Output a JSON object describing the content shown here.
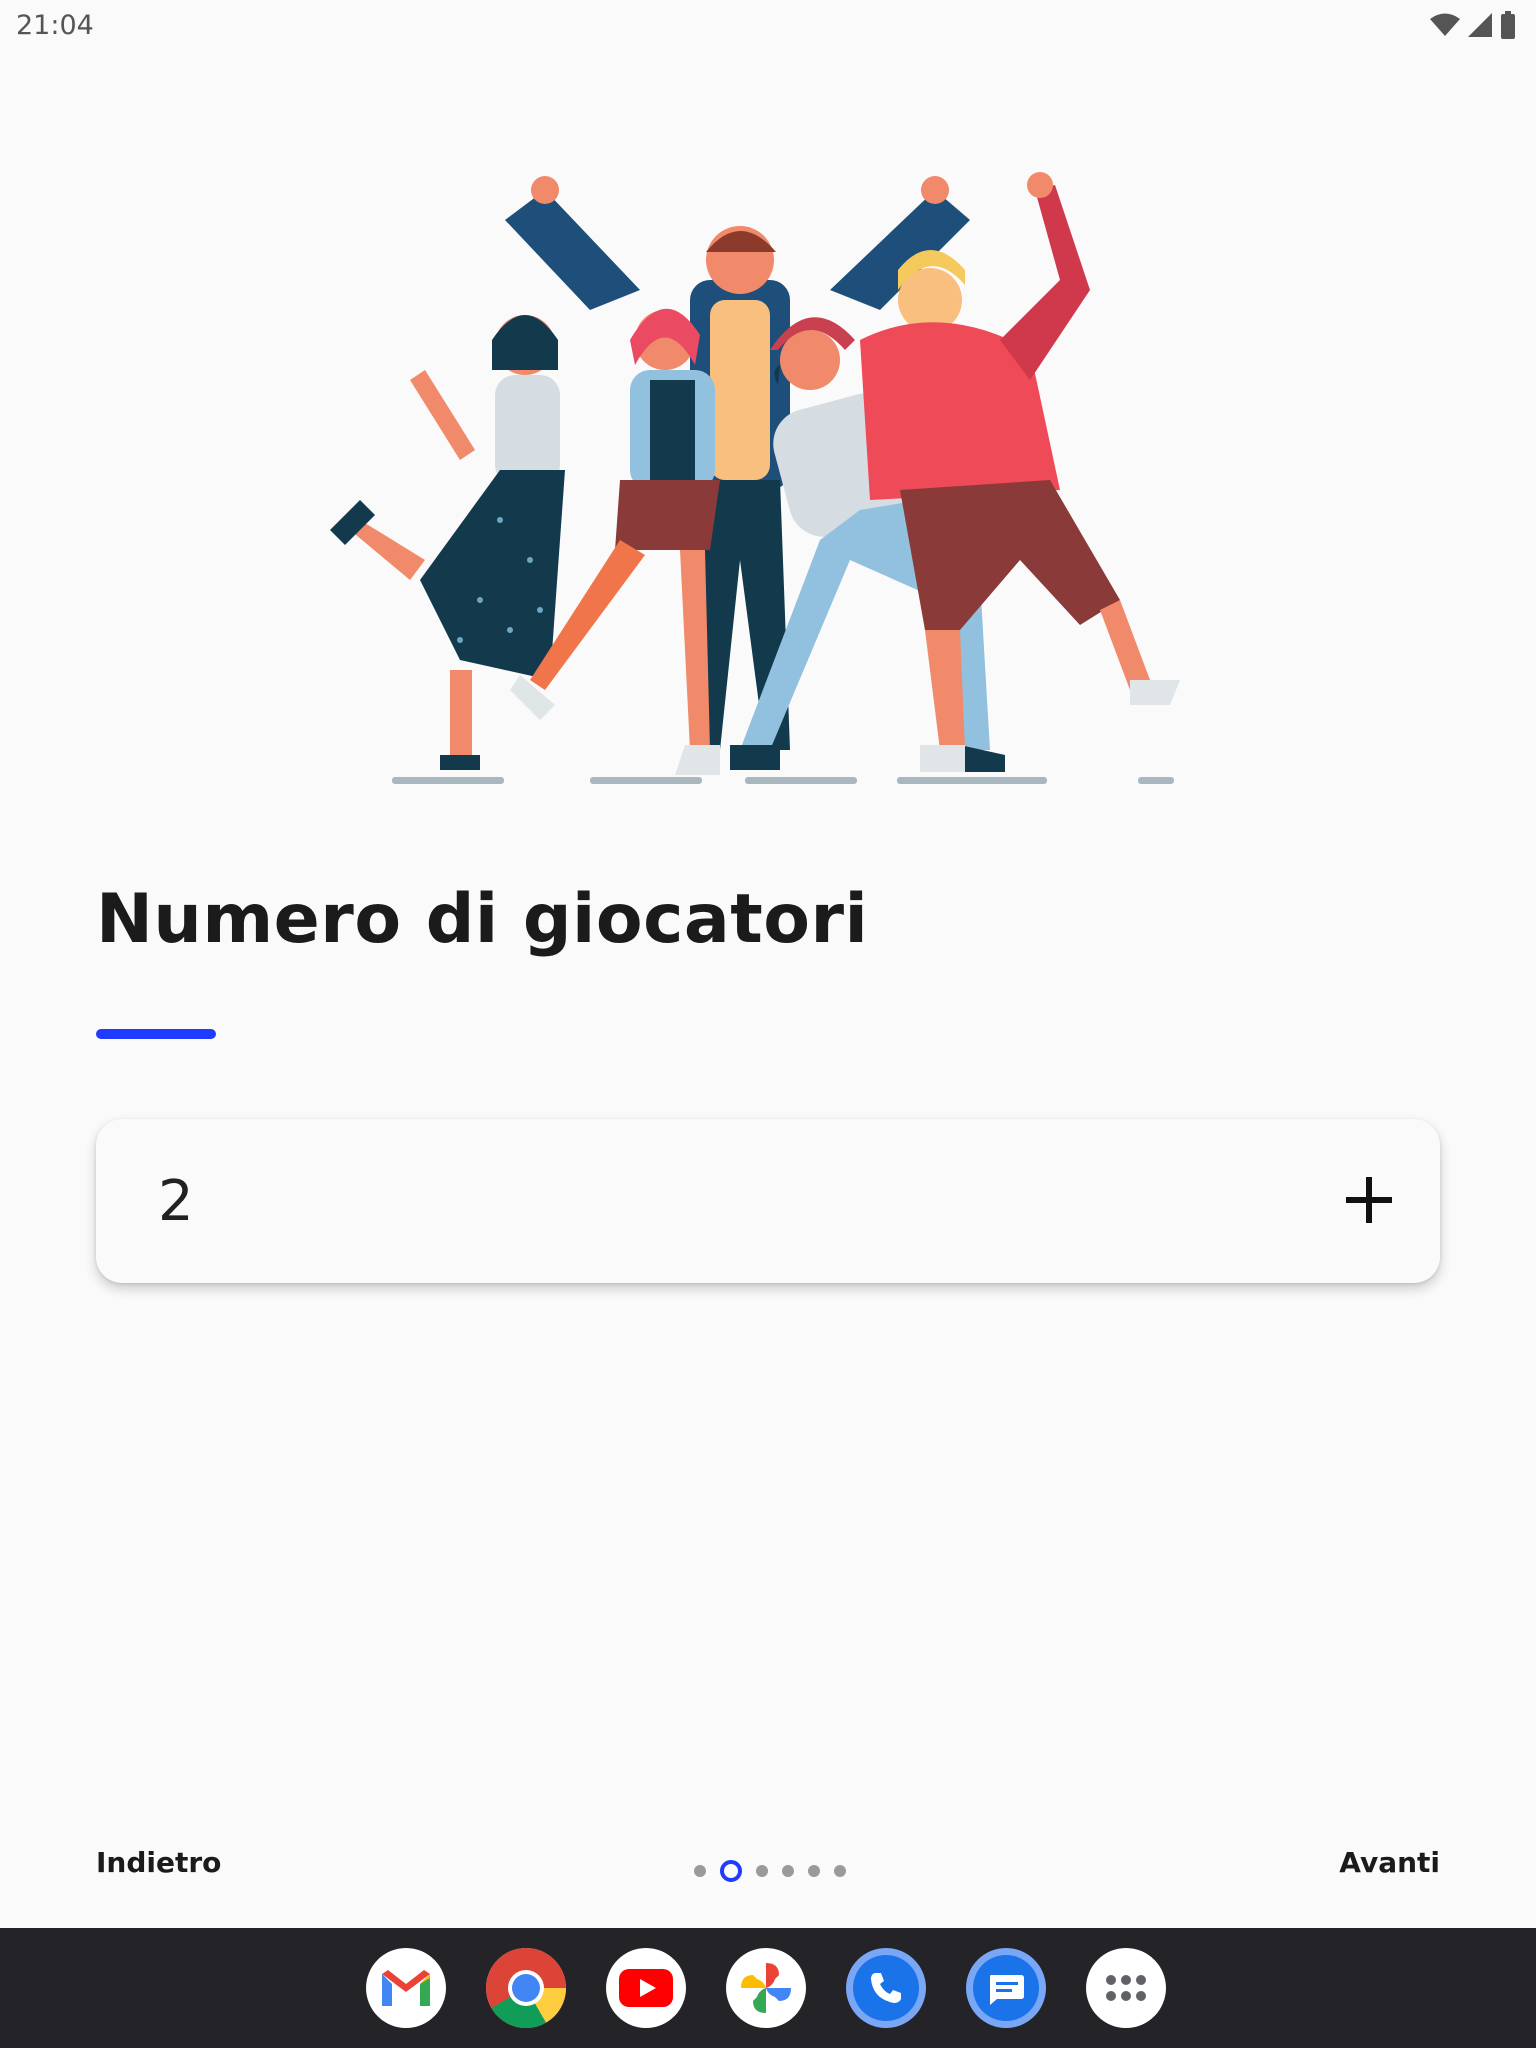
{
  "status_bar": {
    "time": "21:04"
  },
  "page": {
    "title": "Numero di giocatori",
    "player_count": "2"
  },
  "navigation": {
    "back_label": "Indietro",
    "next_label": "Avanti",
    "page_dots": 6,
    "active_page_index": 1
  },
  "dock": {
    "apps": [
      "gmail-icon",
      "chrome-icon",
      "youtube-icon",
      "photos-icon",
      "phone-icon",
      "messages-icon",
      "app-drawer-icon"
    ]
  },
  "colors": {
    "accent": "#1e3bff",
    "background": "#fafafa",
    "taskbar": "#232328"
  }
}
